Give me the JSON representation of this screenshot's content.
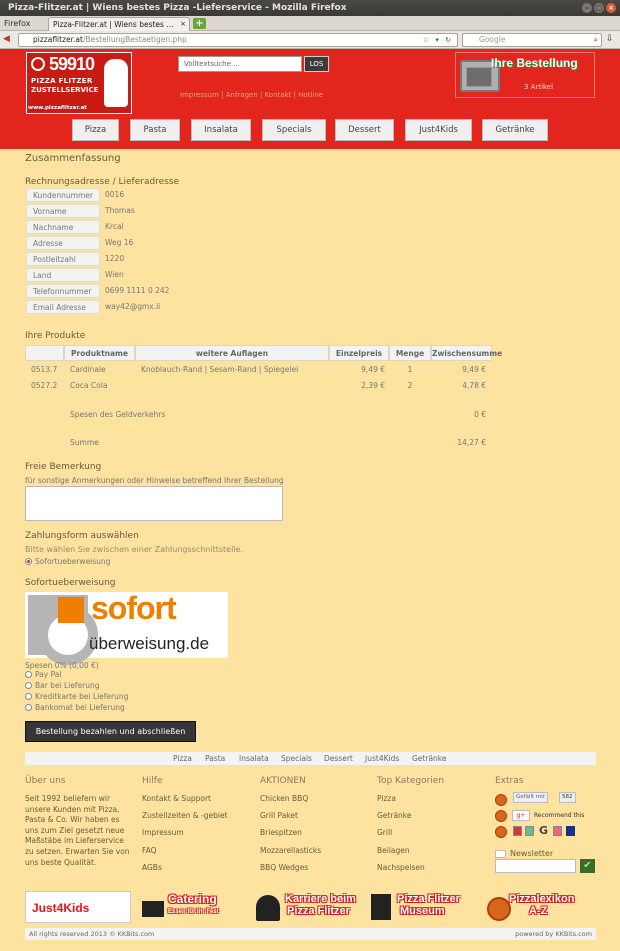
{
  "browser": {
    "window_title": "Pizza-Flitzer.at | Wiens bestes Pizza -Lieferservice - Mozilla Firefox",
    "menu_label": "Firefox",
    "tabs": [
      {
        "label": "Pizza-Flitzer.at | Wiens bestes ..."
      }
    ],
    "url_domain": "pizzaflitzer.at",
    "url_path": "/BestellungBestaetigen.php",
    "search_placeholder": "Google"
  },
  "header": {
    "logo_number": "59910",
    "logo_line1": "PIZZA FLITZER",
    "logo_line2": "ZUSTELLSERVICE",
    "logo_url": "www.pizzaflitzer.at",
    "search_placeholder": "Volltextsuche ...",
    "search_button": "LOS",
    "top_links": "Impressum | Anfragen | Kontakt | Hotline",
    "cart_title": "Ihre Bestellung",
    "cart_count": "3 Artikel",
    "menu": [
      "Pizza",
      "Pasta",
      "Insalata",
      "Specials",
      "Dessert",
      "Just4Kids",
      "Getränke"
    ]
  },
  "summary": {
    "title": "Zusammenfassung",
    "address_title": "Rechnungsadresse / Lieferadresse",
    "address": [
      {
        "label": "Kundennummer",
        "value": "0016"
      },
      {
        "label": "Vorname",
        "value": "Thomas"
      },
      {
        "label": "Nachname",
        "value": "Krcal"
      },
      {
        "label": "Adresse",
        "value": "Weg 16"
      },
      {
        "label": "Postleitzahl",
        "value": "1220"
      },
      {
        "label": "Land",
        "value": "Wien"
      },
      {
        "label": "Telefonnummer",
        "value": "0699 1111 0 242"
      },
      {
        "label": "Email Adresse",
        "value": "way42@gmx.li"
      }
    ]
  },
  "products": {
    "title": "Ihre Produkte",
    "headers": [
      "Produktname",
      "weitere Auflagen",
      "Einzelpreis",
      "Menge",
      "Zwischensumme"
    ],
    "rows": [
      {
        "id": "0513.7",
        "name": "Cardinale",
        "extras": "Knoblauch-Rand | Sesam-Rand | Spiegelei",
        "price": "9,49 €",
        "qty": "1",
        "subtotal": "9,49 €"
      },
      {
        "id": "0527.2",
        "name": "Coca Cola",
        "extras": "",
        "price": "2,39 €",
        "qty": "2",
        "subtotal": "4,78 €"
      }
    ],
    "fees_label": "Spesen des Geldverkehrs",
    "fees_value": "0 €",
    "sum_label": "Summe",
    "sum_value": "14,27 €"
  },
  "remark": {
    "title": "Freie Bemerkung",
    "hint": "für sonstige Anmerkungen oder Hinweise betreffend Ihrer Bestellung"
  },
  "payment": {
    "title": "Zahlungsform auswählen",
    "subtitle": "Bitte wählen Sie zwischen einer Zahlungsschnittstelle.",
    "selected_option": "Sofortueberweisung",
    "section_title": "Sofortueberweisung",
    "logo_word1": "sofort",
    "logo_word2": "überweisung.de",
    "fees": "Spesen 0% (0,00 €)",
    "options": [
      "Pay Pal",
      "Bar bei Lieferung",
      "Kreditkarte bei Lieferung",
      "Bankomat bei Lieferung"
    ],
    "submit": "Bestellung bezahlen und abschließen"
  },
  "footer": {
    "menu": [
      "Pizza",
      "Pasta",
      "Insalata",
      "Specials",
      "Dessert",
      "Just4Kids",
      "Getränke"
    ],
    "about_title": "Über uns",
    "about_text": "Seit 1992 beliefern wir unsere Kunden mit Pizza, Pasta & Co. Wir haben es uns zum Ziel gesetzt neue Maßstäbe im Lieferservice zu setzen. Erwarten Sie von uns beste Qualität.",
    "help_title": "Hilfe",
    "help_items": [
      "Kontakt & Support",
      "Zustellzeiten & -gebiet",
      "Impressum",
      "FAQ",
      "AGBs"
    ],
    "actions_title": "AKTIONEN",
    "actions_items": [
      "Chicken BBQ",
      "Grill Paket",
      "Briespitzen",
      "Mozzarellasticks",
      "BBQ Wedges"
    ],
    "top_title": "Top Kategorien",
    "top_items": [
      "Pizza",
      "Getränke",
      "Grill",
      "Beilagen",
      "Nachspeisen"
    ],
    "extras_title": "Extras",
    "like_label": "Gefällt mir",
    "like_count": "582",
    "recommend_label": "Recommend this",
    "newsletter_label": "Newsletter",
    "newsletter_ok": "✔",
    "banners": [
      "Just4Kids",
      "Catering",
      "Essen für Ihr Fest",
      "Karriere beim",
      "Pizza Flitzer",
      "Pizza Flitzer",
      "Museum",
      "Pizzalexikon",
      "A-Z"
    ],
    "copyright": "All rights reserved 2013 © KKBits.com",
    "powered": "powered by KKBits.com"
  }
}
